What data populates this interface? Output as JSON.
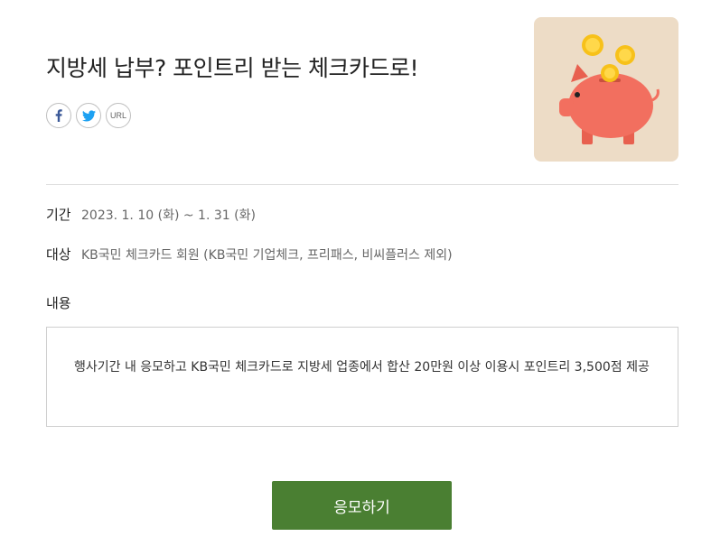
{
  "event": {
    "title": "지방세 납부? 포인트리 받는 체크카드로!",
    "period_label": "기간",
    "period_value": "2023. 1. 10 (화) ~ 1. 31 (화)",
    "target_label": "대상",
    "target_value": "KB국민 체크카드 회원 (KB국민 기업체크, 프리패스, 비씨플러스 제외)",
    "content_label": "내용",
    "content_text": "행사기간 내 응모하고 KB국민 체크카드로 지방세 업종에서 합산 20만원 이상 이용시 포인트리 3,500점 제공"
  },
  "share": {
    "facebook_icon": "facebook-icon",
    "twitter_icon": "twitter-icon",
    "url_label": "URL"
  },
  "thumbnail": {
    "icon": "piggy-bank-with-coins-icon",
    "background_color": "#eddcc6",
    "pig_color": "#f26f5f",
    "coin_color": "#f7c11a"
  },
  "apply_button": {
    "label": "응모하기",
    "color": "#4a7f32"
  }
}
